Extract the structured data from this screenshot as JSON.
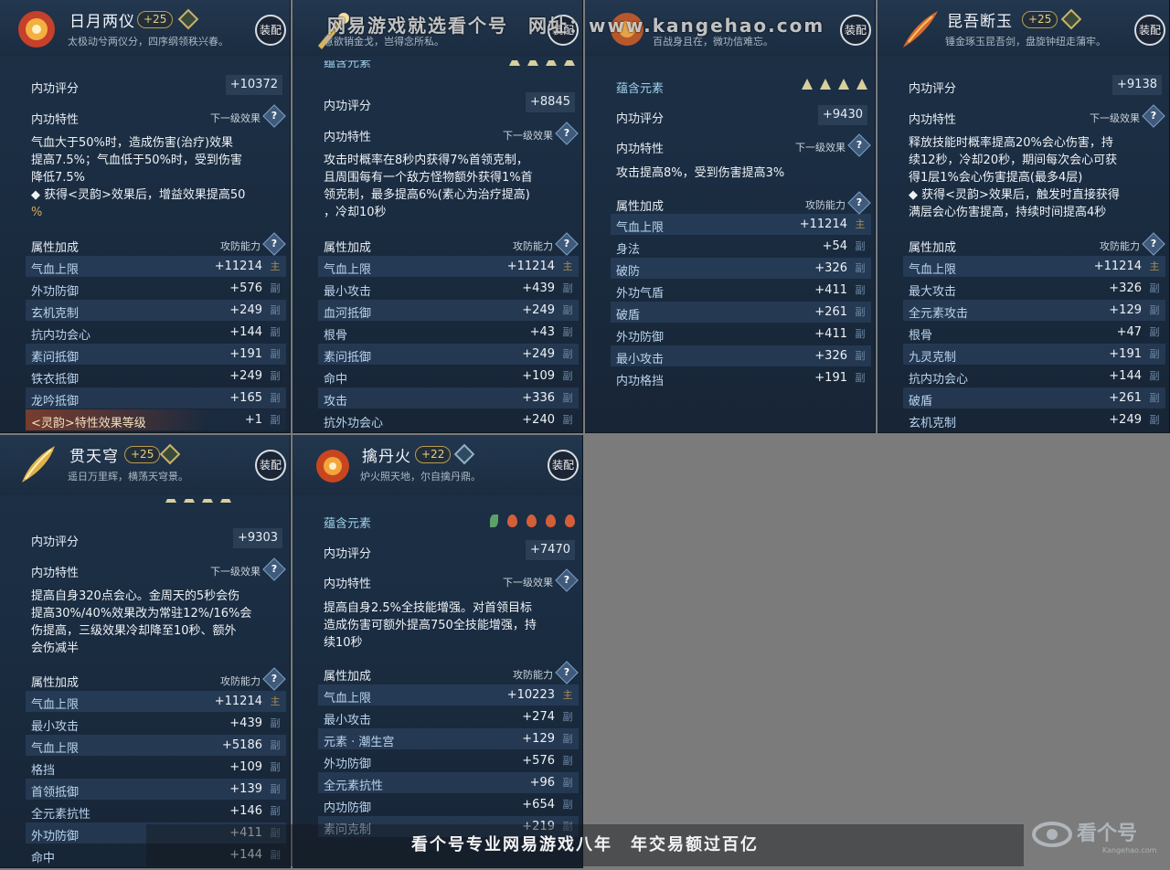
{
  "watermark": {
    "top": "网易游戏就选看个号　网址：www.kangehao.com",
    "bottom": "看个号专业网易游戏八年　年交易额过百亿",
    "logo_text": "看个号",
    "logo_url": "Kangehao.com"
  },
  "panels": [
    {
      "name": "日月两仪",
      "level": "+25",
      "desc": "太极动兮两仪分，四序纲领秩兴春。",
      "equip": "装配",
      "score_label": "内功评分",
      "score": "+10372",
      "trait_label": "内功特性",
      "next_label": "下一级效果",
      "trait_lines": [
        "气血大于50%时，造成伤害(治疗)效果",
        "提高7.5%；气血低于50%时，受到伤害",
        "降低7.5%",
        "◆ 获得<灵韵>效果后，增益效果提高50",
        "%"
      ],
      "attr_label": "属性加成",
      "attr_right": "攻防能力",
      "attrs": [
        {
          "k": "气血上限",
          "v": "+11214",
          "t": "主"
        },
        {
          "k": "外功防御",
          "v": "+576",
          "t": "副"
        },
        {
          "k": "玄机克制",
          "v": "+249",
          "t": "副"
        },
        {
          "k": "抗内功会心",
          "v": "+144",
          "t": "副"
        },
        {
          "k": "素问抵御",
          "v": "+191",
          "t": "副"
        },
        {
          "k": "铁衣抵御",
          "v": "+249",
          "t": "副"
        },
        {
          "k": "龙吟抵御",
          "v": "+165",
          "t": "副"
        },
        {
          "k": "<灵韵>特性效果等级",
          "v": "+1",
          "t": "副"
        }
      ]
    },
    {
      "desc": "意欲销金戈，岂得念所私。",
      "equip": "装配",
      "element_label": "蕴含元素",
      "score_label": "内功评分",
      "score": "+8845",
      "trait_label": "内功特性",
      "next_label": "下一级效果",
      "trait_lines": [
        "攻击时概率在8秒内获得7%首领克制，",
        "且周围每有一个敌方怪物额外获得1%首",
        "领克制，最多提高6%(素心为治疗提高)",
        "，冷却10秒"
      ],
      "attr_label": "属性加成",
      "attr_right": "攻防能力",
      "attrs": [
        {
          "k": "气血上限",
          "v": "+11214",
          "t": "主"
        },
        {
          "k": "最小攻击",
          "v": "+439",
          "t": "副"
        },
        {
          "k": "血河抵御",
          "v": "+249",
          "t": "副"
        },
        {
          "k": "根骨",
          "v": "+43",
          "t": "副"
        },
        {
          "k": "素问抵御",
          "v": "+249",
          "t": "副"
        },
        {
          "k": "命中",
          "v": "+109",
          "t": "副"
        },
        {
          "k": "攻击",
          "v": "+336",
          "t": "副"
        },
        {
          "k": "抗外功会心",
          "v": "+240",
          "t": "副"
        }
      ]
    },
    {
      "desc": "百战身且在，微功信难忘。",
      "equip": "装配",
      "element_label": "蕴含元素",
      "score_label": "内功评分",
      "score": "+9430",
      "trait_label": "内功特性",
      "next_label": "下一级效果",
      "trait_lines": [
        "攻击提高8%，受到伤害提高3%"
      ],
      "attr_label": "属性加成",
      "attr_right": "攻防能力",
      "attrs": [
        {
          "k": "气血上限",
          "v": "+11214",
          "t": "主"
        },
        {
          "k": "身法",
          "v": "+54",
          "t": "副"
        },
        {
          "k": "破防",
          "v": "+326",
          "t": "副"
        },
        {
          "k": "外功气盾",
          "v": "+411",
          "t": "副"
        },
        {
          "k": "破盾",
          "v": "+261",
          "t": "副"
        },
        {
          "k": "外功防御",
          "v": "+411",
          "t": "副"
        },
        {
          "k": "最小攻击",
          "v": "+326",
          "t": "副"
        },
        {
          "k": "内功格挡",
          "v": "+191",
          "t": "副"
        }
      ]
    },
    {
      "name": "昆吾断玉",
      "level": "+25",
      "desc": "锤金琢玉昆吾剑，盘旋钟纽走蒲牢。",
      "equip": "装配",
      "score_label": "内功评分",
      "score": "+9138",
      "trait_label": "内功特性",
      "next_label": "下一级效果",
      "trait_lines": [
        "释放技能时概率提高20%会心伤害，持",
        "续12秒，冷却20秒，期间每次会心可获",
        "得1层1%会心伤害提高(最多4层)",
        "◆ 获得<灵韵>效果后，触发时直接获得",
        "满层会心伤害提高，持续时间提高4秒"
      ],
      "attr_label": "属性加成",
      "attr_right": "攻防能力",
      "attrs": [
        {
          "k": "气血上限",
          "v": "+11214",
          "t": "主"
        },
        {
          "k": "最大攻击",
          "v": "+326",
          "t": "副"
        },
        {
          "k": "全元素攻击",
          "v": "+129",
          "t": "副"
        },
        {
          "k": "根骨",
          "v": "+47",
          "t": "副"
        },
        {
          "k": "九灵克制",
          "v": "+191",
          "t": "副"
        },
        {
          "k": "抗内功会心",
          "v": "+144",
          "t": "副"
        },
        {
          "k": "破盾",
          "v": "+261",
          "t": "副"
        },
        {
          "k": "玄机克制",
          "v": "+249",
          "t": "副"
        }
      ]
    },
    {
      "name": "贯天穹",
      "level": "+25",
      "desc": "遥日万里辉，横荡天穹景。",
      "equip": "装配",
      "score_label": "内功评分",
      "score": "+9303",
      "trait_label": "内功特性",
      "next_label": "下一级效果",
      "trait_lines": [
        "提高自身320点会心。金周天的5秒会伤",
        "提高30%/40%效果改为常驻12%/16%会",
        "伤提高，三级效果冷却降至10秒、额外",
        "会伤减半"
      ],
      "attr_label": "属性加成",
      "attr_right": "攻防能力",
      "attrs": [
        {
          "k": "气血上限",
          "v": "+11214",
          "t": "主"
        },
        {
          "k": "最小攻击",
          "v": "+439",
          "t": "副"
        },
        {
          "k": "气血上限",
          "v": "+5186",
          "t": "副"
        },
        {
          "k": "格挡",
          "v": "+109",
          "t": "副"
        },
        {
          "k": "首领抵御",
          "v": "+139",
          "t": "副"
        },
        {
          "k": "全元素抗性",
          "v": "+146",
          "t": "副"
        },
        {
          "k": "外功防御",
          "v": "+411",
          "t": "副"
        },
        {
          "k": "命中",
          "v": "+144",
          "t": "副"
        }
      ]
    },
    {
      "name": "擒丹火",
      "level": "+22",
      "desc": "炉火照天地，尔自擒丹鼎。",
      "equip": "装配",
      "element_label": "蕴含元素",
      "score_label": "内功评分",
      "score": "+7470",
      "trait_label": "内功特性",
      "next_label": "下一级效果",
      "trait_lines": [
        "提高自身2.5%全技能增强。对首领目标",
        "造成伤害可额外提高750全技能增强，持",
        "续10秒"
      ],
      "attr_label": "属性加成",
      "attr_right": "攻防能力",
      "attrs": [
        {
          "k": "气血上限",
          "v": "+10223",
          "t": "主"
        },
        {
          "k": "最小攻击",
          "v": "+274",
          "t": "副"
        },
        {
          "k": "元素 · 潮生宫",
          "v": "+129",
          "t": "副"
        },
        {
          "k": "外功防御",
          "v": "+576",
          "t": "副"
        },
        {
          "k": "全元素抗性",
          "v": "+96",
          "t": "副"
        },
        {
          "k": "内功防御",
          "v": "+654",
          "t": "副"
        },
        {
          "k": "素问克制",
          "v": "+219",
          "t": "副"
        }
      ]
    }
  ],
  "colors": {
    "panel_bg": "#1b2d42",
    "highlight": "#d8a85a",
    "attr_key": "#b9d4ee",
    "page_bg": "#7b7b7b"
  }
}
